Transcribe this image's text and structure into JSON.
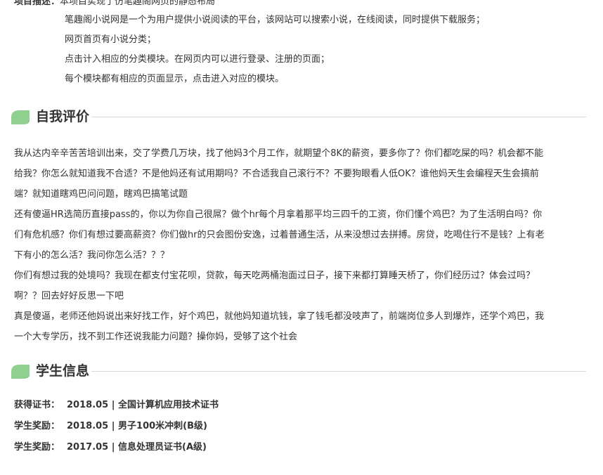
{
  "project": {
    "label": "项目描述：",
    "top_partial": "本项目实现了仿笔趣阁网页的静态布局",
    "lines": [
      "笔趣阁小说网是一个为用户提供小说阅读的平台，该网站可以搜索小说，在线阅读，同时提供下载服务；",
      "网页首页有小说分类；",
      "点击计入相应的分类模块。在网页内可以进行登录、注册的页面；",
      "每个模块都有相应的页面显示，点击进入对应的模块。"
    ]
  },
  "self_eval": {
    "title": "自我评价",
    "lines": [
      "我从达内辛辛苦苦培训出来，交了学费几万块，找了他妈3个月工作，就期望个8K的薪资，要多你了？你们都吃屎的吗？机会都不能",
      "给我？你怎么就知道我不合适？不是他妈还有试用期吗？不合适我自己滚行不？不要狗眼看人低OK？谁他妈天生会编程天生会搞前",
      "端？就知道瞎鸡巴问问题，瞎鸡巴搞笔试题",
      "还有傻逼HR选简历直接pass的，你以为你自己很屌？做个hr每个月拿着那平均三四千的工资，你们懂个鸡巴？为了生活明白吗？你",
      "们有危机感？你们有想过要高薪资？你们做hr的只会图份安逸，过着普通生活，从来没想过去拼搏。房贷，吃喝住行不是钱？上有老",
      "下有小的怎么活？我问你怎么活？？？",
      "你们有想过我的处境吗？我现在都支付宝花呗，贷款，每天吃两桶泡面过日子，接下来都打算睡天桥了，你们经历过？体会过吗？",
      "啊？？回去好好反思一下吧",
      "真是傻逼，老师还他妈说出来好找工作，好个鸡巴，就他妈知道坑钱，拿了钱毛都没吱声了，前端岗位多人到爆炸，还学个鸡巴，我",
      "一个大专学历，找不到工作还说我能力问题？操你妈，受够了这个社会"
    ]
  },
  "student_info": {
    "title": "学生信息",
    "rows": [
      {
        "key": "获得证书：",
        "value": "2018.05 | 全国计算机应用技术证书"
      },
      {
        "key": "学生奖励：",
        "value": "2018.05 | 男子100米冲刺(B级)"
      },
      {
        "key": "学生奖励：",
        "value": "2017.05 | 信息处理员证书(A级)"
      }
    ]
  },
  "colors": {
    "icon_green": "#8fcf8f",
    "icon_green_dark": "#6fbf73",
    "text": "#333333",
    "rule": "#d8d8d8"
  }
}
